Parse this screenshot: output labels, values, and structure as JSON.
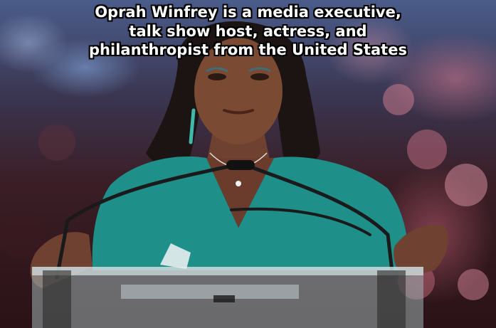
{
  "caption": {
    "lines": [
      "Oprah Winfrey is a media executive,",
      "talk show host, actress, and",
      "philanthropist from the United States"
    ]
  },
  "colors": {
    "dress": "#1f8f8a",
    "skin": "#7a4a33",
    "hair": "#1b1412",
    "podium": "#9fb3b5"
  }
}
